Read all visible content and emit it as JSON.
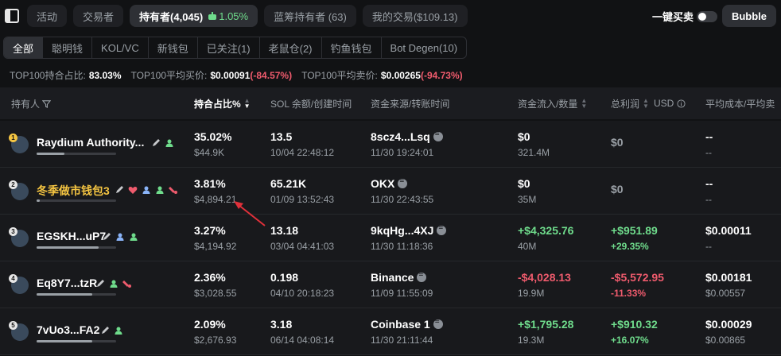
{
  "tabs": [
    {
      "label": "活动"
    },
    {
      "label": "交易者"
    },
    {
      "label": "持有者(4,045)",
      "pct": "1.05%",
      "active": true
    },
    {
      "label": "蓝筹持有者 (63)"
    },
    {
      "label": "我的交易($109.13)"
    }
  ],
  "one_click_label": "一键买卖",
  "bubble_label": "Bubble",
  "filters": [
    "全部",
    "聪明钱",
    "KOL/VC",
    "新钱包",
    "已关注(1)",
    "老鼠仓(2)",
    "钓鱼钱包",
    "Bot Degen(10)"
  ],
  "stats": {
    "top100_hold_label": "TOP100持合占比:",
    "top100_hold_value": "83.03%",
    "top100_buy_label": "TOP100平均买价:",
    "top100_buy_value": "$0.00091",
    "top100_buy_change": "(-84.57%)",
    "top100_sell_label": "TOP100平均卖价:",
    "top100_sell_value": "$0.00265",
    "top100_sell_change": "(-94.73%)"
  },
  "headers": {
    "holder": "持有人",
    "hold_pct": "持合占比%",
    "sol_balance": "SOL 余额/创建时间",
    "fund_source": "资金来源/转账时间",
    "fund_flow": "资金流入/数量",
    "total_profit": "总利润",
    "profit_unit": "USD",
    "avg_cost": "平均成本/平均卖"
  },
  "rows": [
    {
      "rank": "1",
      "name": "Raydium Authority...",
      "bar": 0.35,
      "hold_pct": "35.02%",
      "hold_usd": "$44.9K",
      "sol": "13.5",
      "created": "10/04 22:48:12",
      "source": "8scz4...Lsq",
      "source_time": "11/30 19:24:01",
      "flow": "$0",
      "qty": "321.4M",
      "profit": "$0",
      "profit_pct": "",
      "avg_cost": "--",
      "avg_sell": "--",
      "highlight": false
    },
    {
      "rank": "2",
      "name": "冬季做市钱包3",
      "bar": 0.04,
      "hold_pct": "3.81%",
      "hold_usd": "$4,894.21",
      "sol": "65.21K",
      "created": "01/09 13:52:43",
      "source": "OKX",
      "source_time": "11/30 22:43:55",
      "flow": "$0",
      "qty": "35M",
      "profit": "$0",
      "profit_pct": "",
      "avg_cost": "--",
      "avg_sell": "--",
      "highlight": true
    },
    {
      "rank": "3",
      "name": "EGSKH...uP7",
      "bar": 0.78,
      "hold_pct": "3.27%",
      "hold_usd": "$4,194.92",
      "sol": "13.18",
      "created": "03/04 04:41:03",
      "source": "9kqHg...4XJ",
      "source_time": "11/30 11:18:36",
      "flow": "+$4,325.76",
      "qty": "40M",
      "profit": "+$951.89",
      "profit_pct": "+29.35%",
      "avg_cost": "$0.00011",
      "avg_sell": "--",
      "highlight": false
    },
    {
      "rank": "4",
      "name": "Eq8Y7...tzR",
      "bar": 0.7,
      "hold_pct": "2.36%",
      "hold_usd": "$3,028.55",
      "sol": "0.198",
      "created": "04/10 20:18:23",
      "source": "Binance",
      "source_time": "11/09 11:55:09",
      "flow": "-$4,028.13",
      "qty": "19.9M",
      "profit": "-$5,572.95",
      "profit_pct": "-11.33%",
      "avg_cost": "$0.00181",
      "avg_sell": "$0.00557",
      "highlight": false
    },
    {
      "rank": "5",
      "name": "7vUo3...FA2",
      "bar": 0.7,
      "hold_pct": "2.09%",
      "hold_usd": "$2,676.93",
      "sol": "3.18",
      "created": "06/14 04:08:14",
      "source": "Coinbase 1",
      "source_time": "11/30 21:11:44",
      "flow": "+$1,795.28",
      "qty": "19.3M",
      "profit": "+$910.32",
      "profit_pct": "+16.07%",
      "avg_cost": "$0.00029",
      "avg_sell": "$0.00865",
      "highlight": false
    }
  ],
  "colors": {
    "positive": "#6fdc8c",
    "negative": "#ef5b6d",
    "highlight": "#f5c542",
    "annotation": "#e0303a"
  }
}
